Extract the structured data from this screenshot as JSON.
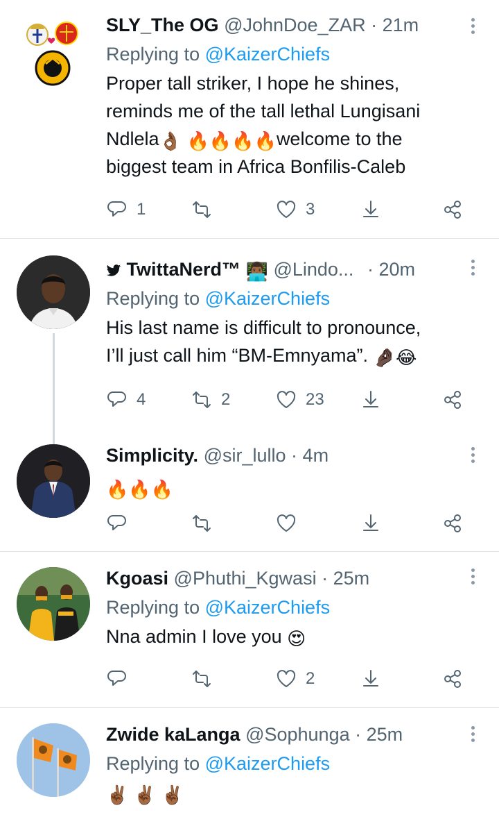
{
  "tweets": [
    {
      "name": "SLY_The OG",
      "handle": "@JohnDoe_ZAR",
      "time": "21m",
      "replying_prefix": "Replying to",
      "replying_to": "@KaizerChiefs",
      "text_lines": [
        "Proper tall striker, I hope he shines,",
        "reminds me of the tall lethal Lungisani",
        "Ndlela",
        "welcome to the",
        "biggest team in Africa Bonfilis-Caleb"
      ],
      "counts": {
        "reply": "1",
        "retweet": "",
        "like": "3"
      }
    },
    {
      "name": "TwittaNerd™",
      "handle": "@Lindo...",
      "time": "20m",
      "replying_prefix": "Replying to",
      "replying_to": "@KaizerChiefs",
      "text_lines": [
        "His last name is difficult to pronounce,",
        "I’ll just call him “BM-Emnyama”."
      ],
      "counts": {
        "reply": "4",
        "retweet": "2",
        "like": "23"
      }
    },
    {
      "name": "Simplicity.",
      "handle": "@sir_lullo",
      "time": "4m",
      "counts": {
        "reply": "",
        "retweet": "",
        "like": ""
      }
    },
    {
      "name": "Kgoasi",
      "handle": "@Phuthi_Kgwasi",
      "time": "25m",
      "replying_prefix": "Replying to",
      "replying_to": "@KaizerChiefs",
      "text_lines": [
        "Nna admin I love you"
      ],
      "counts": {
        "reply": "",
        "retweet": "",
        "like": "2"
      }
    },
    {
      "name": "Zwide kaLanga",
      "handle": "@Sophunga",
      "time": "25m",
      "replying_prefix": "Replying to",
      "replying_to": "@KaizerChiefs"
    }
  ],
  "separator": "·",
  "emojis": {
    "ok_hand": "👌🏾",
    "fire": "🔥",
    "pinched": "🤌🏿",
    "joy": "😂",
    "heart_eyes": "😍",
    "victory": "✌🏾",
    "technologist": "👨🏾‍💻"
  },
  "colors": {
    "link": "#1d9bf0",
    "muted": "#536471",
    "divider": "#dfe4e8",
    "text": "#0f1419"
  }
}
